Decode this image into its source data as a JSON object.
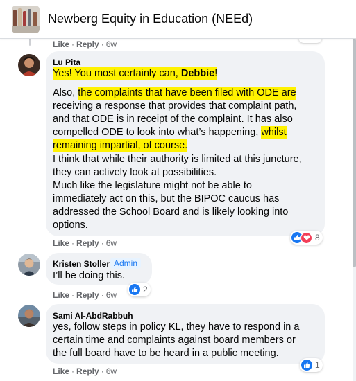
{
  "header": {
    "title": "Newberg Equity in Education (NEEd)"
  },
  "comments": [
    {
      "actions": {
        "like": "Like",
        "reply": "Reply",
        "time": "6w"
      }
    },
    {
      "author": "Lu Pita",
      "paragraphs": [
        {
          "pre": "",
          "hl": "Yes! You most certainly can, ",
          "bold": "Debbie",
          "post": "!"
        },
        {
          "l1a": "Also, ",
          "l1b": "the complaints that have been filed with ODE are",
          "l2": "receiving a response that provides that complaint path,",
          "l3": "and that ODE is in receipt of the complaint. It has also",
          "l4a": "compelled ODE to look into what’s happening, ",
          "l4b": "whilst",
          "l5": "remaining impartial, of course."
        },
        {
          "lines": [
            "I think that while their authority is limited at this juncture,",
            "they can actively look at possibilities.",
            "Much like the legislature might not be able to",
            "immediately act on this, but the BIPOC caucus has",
            "addressed the School Board and is likely looking into",
            "options."
          ]
        }
      ],
      "reaction_count": "8",
      "actions": {
        "like": "Like",
        "reply": "Reply",
        "time": "6w"
      }
    },
    {
      "author": "Kristen Stoller",
      "badge": "Admin",
      "text": "I’ll be doing this.",
      "reaction_count": "2",
      "actions": {
        "like": "Like",
        "reply": "Reply",
        "time": "6w"
      }
    },
    {
      "author": "Sami Al-AbdRabbuh",
      "lines": [
        "yes, follow steps in policy KL, they have to respond in a",
        "certain time and complaints against board members or",
        "the full board have to be heard in a public meeting."
      ],
      "reaction_count": "1",
      "actions": {
        "like": "Like",
        "reply": "Reply",
        "time": "6w"
      }
    }
  ],
  "icons": [
    "like-reaction-icon",
    "love-reaction-icon"
  ],
  "colors": {
    "highlight": "#fff200",
    "like": "#1877f2",
    "love": "#f33e58",
    "bubble": "#f0f2f5",
    "meta": "#65676b"
  }
}
